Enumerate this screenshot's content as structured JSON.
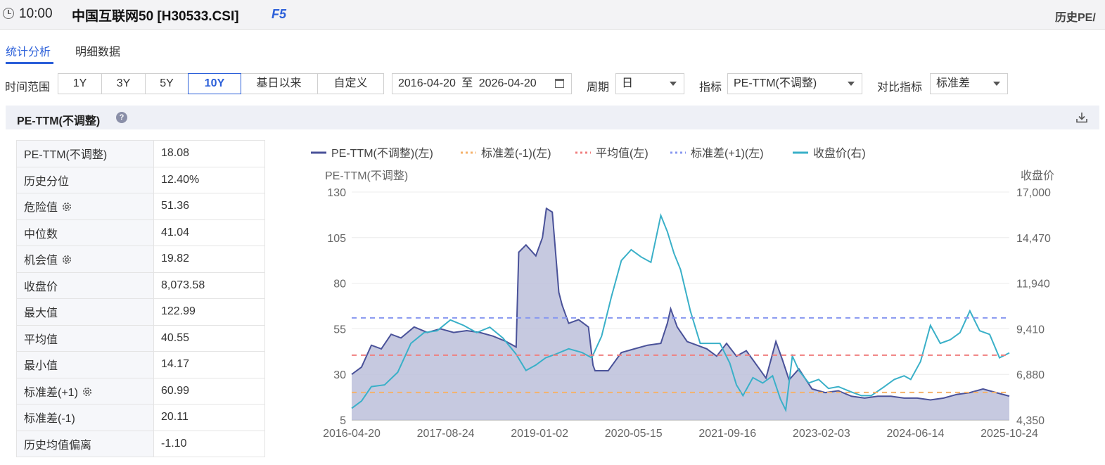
{
  "topbar": {
    "time": "10:00",
    "title": "中国互联网50 [H30533.CSI]",
    "hotkey": "F5",
    "right_title": "历史PE/"
  },
  "tabs": [
    {
      "label": "统计分析",
      "active": true
    },
    {
      "label": "明细数据",
      "active": false
    }
  ],
  "filters": {
    "time_range_label": "时间范围",
    "ranges": [
      "1Y",
      "3Y",
      "5Y",
      "10Y",
      "基日以来",
      "自定义"
    ],
    "active_range": "10Y",
    "date_start": "2016-04-20",
    "date_sep": "至",
    "date_end": "2026-04-20",
    "period_label": "周期",
    "period_value": "日",
    "indicator_label": "指标",
    "indicator_value": "PE-TTM(不调整)",
    "compare_label": "对比指标",
    "compare_value": "标准差"
  },
  "panel": {
    "title": "PE-TTM(不调整)",
    "help": "?"
  },
  "stats": [
    {
      "key": "PE-TTM(不调整)",
      "value": "18.08",
      "gear": false
    },
    {
      "key": "历史分位",
      "value": "12.40%",
      "gear": false
    },
    {
      "key": "危险值",
      "value": "51.36",
      "gear": true
    },
    {
      "key": "中位数",
      "value": "41.04",
      "gear": false
    },
    {
      "key": "机会值",
      "value": "19.82",
      "gear": true
    },
    {
      "key": "收盘价",
      "value": "8,073.58",
      "gear": false
    },
    {
      "key": "最大值",
      "value": "122.99",
      "gear": false
    },
    {
      "key": "平均值",
      "value": "40.55",
      "gear": false
    },
    {
      "key": "最小值",
      "value": "14.17",
      "gear": false
    },
    {
      "key": "标准差(+1)",
      "value": "60.99",
      "gear": true
    },
    {
      "key": "标准差(-1)",
      "value": "20.11",
      "gear": false
    },
    {
      "key": "历史均值偏离",
      "value": "-1.10",
      "gear": false
    }
  ],
  "colors": {
    "pe": "#4a5299",
    "pe_fill": "#bcc0da",
    "close": "#3ab0c8",
    "sd_minus": "#f5b26b",
    "mean": "#f07f7f",
    "sd_plus": "#8898f0",
    "accent": "#2b5fd9"
  },
  "chart_data": {
    "type": "line",
    "ylabel_left": "PE-TTM(不调整)",
    "ylabel_right": "收盘价",
    "ylim_left": [
      5,
      130
    ],
    "yticks_left": [
      "130",
      "105",
      "80",
      "55",
      "30",
      "5"
    ],
    "ylim_right": [
      4350,
      17000
    ],
    "yticks_right": [
      "17,000",
      "14,470",
      "11,940",
      "9,410",
      "6,880",
      "4,350"
    ],
    "x_ticks": [
      "2016-04-20",
      "2017-08-24",
      "2019-01-02",
      "2020-05-15",
      "2021-09-16",
      "2023-02-03",
      "2024-06-14",
      "2025-10-24"
    ],
    "x_range": [
      2016.3,
      2026.3
    ],
    "grid": true,
    "legend_position": "top",
    "series": [
      {
        "name": "PE-TTM(不调整)(左)",
        "axis": "left",
        "style": "area",
        "x": [
          2016.3,
          2016.45,
          2016.6,
          2016.75,
          2016.9,
          2017.05,
          2017.25,
          2017.45,
          2017.65,
          2017.85,
          2018.05,
          2018.25,
          2018.45,
          2018.65,
          2018.8,
          2018.84,
          2018.95,
          2019.1,
          2019.2,
          2019.26,
          2019.35,
          2019.45,
          2019.5,
          2019.6,
          2019.75,
          2019.9,
          2019.97,
          2020.0,
          2020.2,
          2020.4,
          2020.6,
          2020.8,
          2021.0,
          2021.1,
          2021.15,
          2021.25,
          2021.4,
          2021.55,
          2021.7,
          2021.85,
          2022.0,
          2022.15,
          2022.3,
          2022.4,
          2022.5,
          2022.6,
          2022.75,
          2022.85,
          2022.95,
          2023.1,
          2023.3,
          2023.5,
          2023.7,
          2023.9,
          2024.1,
          2024.3,
          2024.5,
          2024.7,
          2024.9,
          2025.1,
          2025.3,
          2025.5,
          2025.7,
          2025.9,
          2026.1,
          2026.3
        ],
        "y": [
          30,
          34,
          46,
          44,
          52,
          50,
          56,
          53,
          55,
          53,
          54,
          53,
          51,
          48,
          45,
          97,
          101,
          95,
          105,
          121,
          119,
          75,
          68,
          58,
          60,
          56,
          35,
          32,
          32,
          42,
          44,
          46,
          47,
          58,
          66,
          56,
          48,
          46,
          44,
          40,
          47,
          40,
          43,
          38,
          33,
          28,
          48,
          38,
          27,
          33,
          22,
          20,
          21,
          18,
          17,
          18,
          18,
          17,
          17,
          16,
          17,
          19,
          20,
          22,
          20,
          18.08
        ]
      },
      {
        "name": "标准差(-1)(左)",
        "axis": "left",
        "style": "dashed",
        "value": 20.11
      },
      {
        "name": "平均值(左)",
        "axis": "left",
        "style": "dashed",
        "value": 40.55
      },
      {
        "name": "标准差(+1)(左)",
        "axis": "left",
        "style": "dashed",
        "value": 60.99
      },
      {
        "name": "收盘价(右)",
        "axis": "right",
        "style": "line",
        "x": [
          2016.3,
          2016.45,
          2016.6,
          2016.8,
          2017.0,
          2017.2,
          2017.4,
          2017.6,
          2017.8,
          2018.0,
          2018.2,
          2018.4,
          2018.6,
          2018.8,
          2018.95,
          2019.1,
          2019.25,
          2019.4,
          2019.6,
          2019.8,
          2019.95,
          2020.1,
          2020.25,
          2020.4,
          2020.55,
          2020.7,
          2020.85,
          2021.0,
          2021.1,
          2021.2,
          2021.3,
          2021.45,
          2021.6,
          2021.75,
          2021.9,
          2022.05,
          2022.15,
          2022.25,
          2022.4,
          2022.55,
          2022.7,
          2022.82,
          2022.9,
          2023.0,
          2023.1,
          2023.25,
          2023.4,
          2023.55,
          2023.7,
          2023.9,
          2024.05,
          2024.2,
          2024.4,
          2024.55,
          2024.7,
          2024.8,
          2024.95,
          2025.1,
          2025.25,
          2025.4,
          2025.55,
          2025.7,
          2025.85,
          2026.0,
          2026.15,
          2026.3
        ],
        "y": [
          5000,
          5400,
          6200,
          6300,
          7000,
          8600,
          9200,
          9300,
          9900,
          9600,
          9200,
          9500,
          8900,
          8000,
          7100,
          7400,
          7800,
          8000,
          8300,
          8100,
          7800,
          9000,
          11200,
          13200,
          13800,
          13400,
          13100,
          15700,
          14800,
          13600,
          12700,
          10400,
          8600,
          8600,
          8600,
          7500,
          6300,
          5700,
          6700,
          6400,
          6800,
          5500,
          4900,
          7900,
          7100,
          6400,
          6600,
          6100,
          6200,
          5900,
          5700,
          5700,
          6200,
          6600,
          6800,
          6600,
          7600,
          9600,
          8600,
          8800,
          9200,
          10400,
          9300,
          9100,
          7800,
          8073.58
        ]
      }
    ]
  }
}
